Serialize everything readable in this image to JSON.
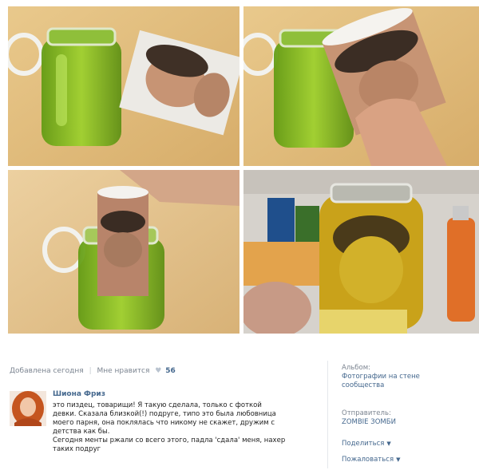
{
  "post": {
    "added_text": "Добавлена сегодня",
    "like_text": "Мне нравится",
    "like_count": "56"
  },
  "comment": {
    "author": "Шиона Фриз",
    "lines": [
      "это пиздец, товарищи! Я такую сделала, только с фоткой",
      "девки. Сказала близкой(!) подруге, типо это была любовница",
      "моего парня, она поклялась что никому не скажет, дружим с",
      "детства как бы.",
      "Сегодня менты ржали со всего этого, падла 'сдала' меня, нахер",
      "таких подруг"
    ]
  },
  "sidebar": {
    "album_label": "Альбом:",
    "album_value_1": "Фотографии на стене",
    "album_value_2": "сообщества",
    "sender_label": "Отправитель:",
    "sender_value": "ZOMBIE ЗОМБИ",
    "share_label": "Поделиться",
    "report_label": "Пожаловаться"
  },
  "colors": {
    "link": "#45688e",
    "muted": "#7c8591",
    "jar_liquid": "#7fb81e"
  }
}
